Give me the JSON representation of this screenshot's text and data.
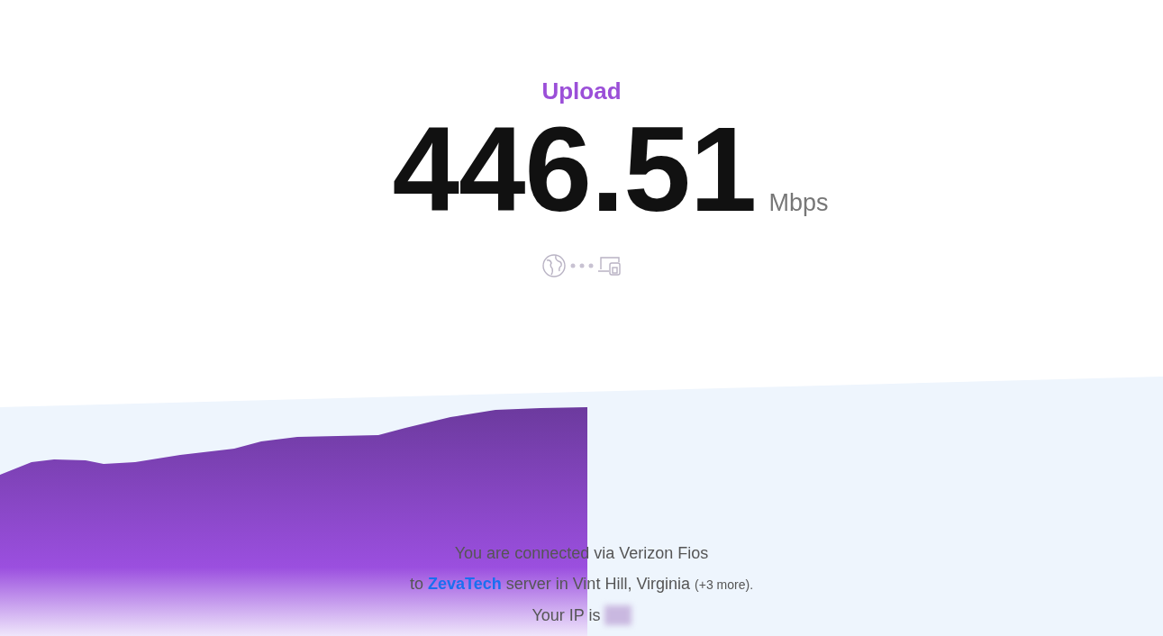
{
  "test": {
    "label": "Upload",
    "value": "446.51",
    "unit": "Mbps"
  },
  "connection": {
    "line_1": "You are connected via Verizon Fios",
    "line_2": {
      "prefix": "to",
      "provider": "ZevaTech",
      "suffix": "server in Vint Hill, Virginia",
      "note": "(+3 more)."
    },
    "line_3": "Your IP is"
  }
}
